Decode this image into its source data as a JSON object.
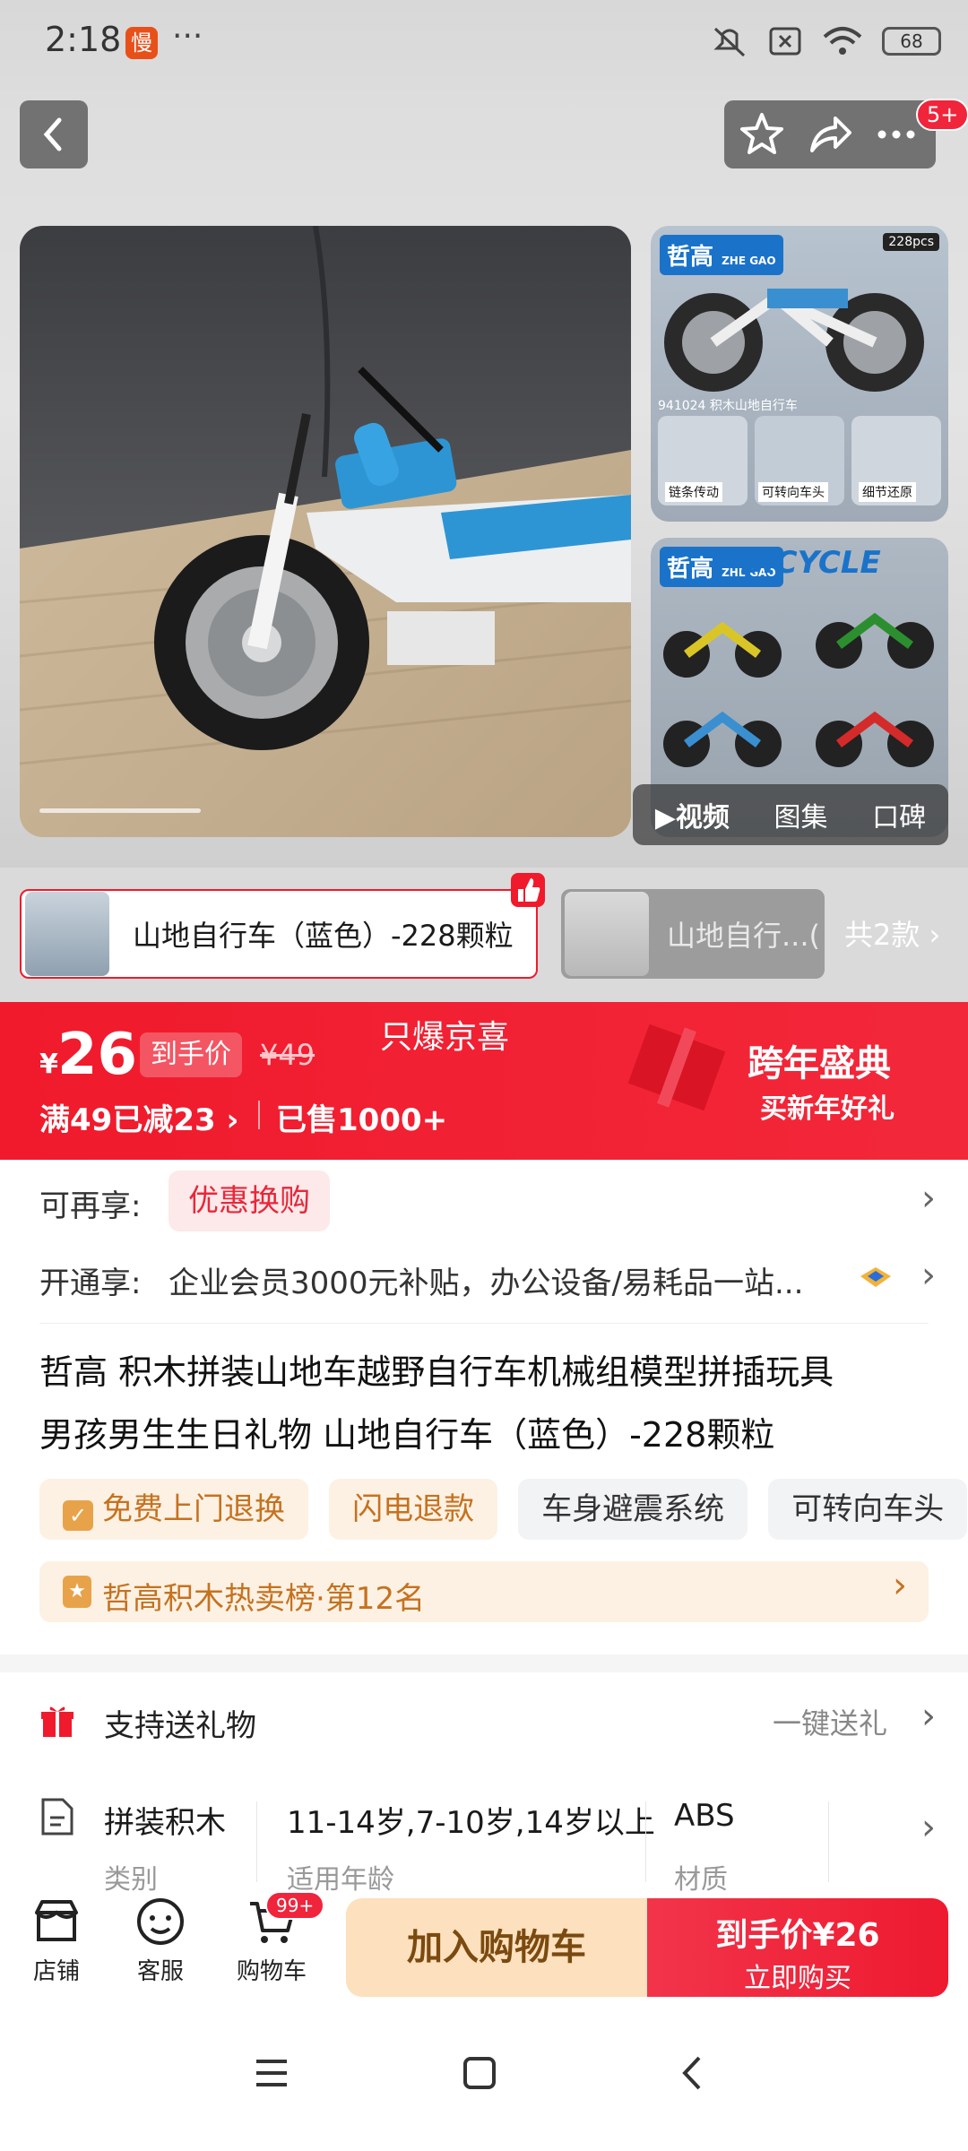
{
  "status_bar": {
    "time": "2:18",
    "app_icon_glyph": "慢",
    "more": "···",
    "battery": "68"
  },
  "header": {
    "badge": "5+"
  },
  "media": {
    "tabs": [
      "视频",
      "图集",
      "口碑"
    ],
    "active_tab": "视频"
  },
  "variants": {
    "selected": "山地自行车（蓝色）-228颗粒",
    "other": "山地自行...(",
    "count": "共2款"
  },
  "price": {
    "currency": "¥",
    "amount": "26",
    "final_label": "到手价",
    "original": "¥49",
    "promo_center": "只爆京喜",
    "discount": "满49已减23",
    "sold": "已售1000+",
    "event_title": "跨年盛典",
    "event_sub": "买新年好礼"
  },
  "benefits": {
    "label1": "可再享:",
    "tag1": "优惠换购",
    "label2": "开通享:",
    "text2": "企业会员3000元补贴，办公设备/易耗品一站..."
  },
  "title": {
    "brand": "哲高",
    "line1": "积木拼装山地车越野自行车机械组模型拼插玩具",
    "line2": "男孩男生生日礼物 山地自行车（蓝色）-228颗粒"
  },
  "feature_tags": [
    "免费上门退换",
    "闪电退款",
    "车身避震系统",
    "可转向车头"
  ],
  "ranking": "哲高积木热卖榜·第12名",
  "gift": {
    "label": "支持送礼物",
    "action": "一键送礼"
  },
  "specs": [
    {
      "value": "拼装积木",
      "key": "类别"
    },
    {
      "value": "11-14岁,7-10岁,14岁以上",
      "key": "适用年龄"
    },
    {
      "value": "ABS",
      "key": "材质"
    }
  ],
  "bottom_bar": {
    "shop": "店铺",
    "service": "客服",
    "cart": "购物车",
    "cart_badge": "99+",
    "add_to_cart": "加入购物车",
    "buy_price": "到手价¥26",
    "buy_now": "立即购买"
  },
  "thumb1": {
    "brand": "哲高",
    "brand_en": "ZHE GAO",
    "pcs": "228pcs",
    "code": "941024 积木山地自行车",
    "cap1": "链条传动",
    "cap2": "可转向车头",
    "cap3": "细节还原"
  },
  "thumb2": {
    "brand": "哲高",
    "brand_en": "ZHE GAO",
    "bicycle": "BICYCLE"
  },
  "colors": {
    "accent": "#f01a2c",
    "tag_bg": "#fdf1e4",
    "tag_text": "#c5721f",
    "cart_btn": "#fde0bd"
  }
}
